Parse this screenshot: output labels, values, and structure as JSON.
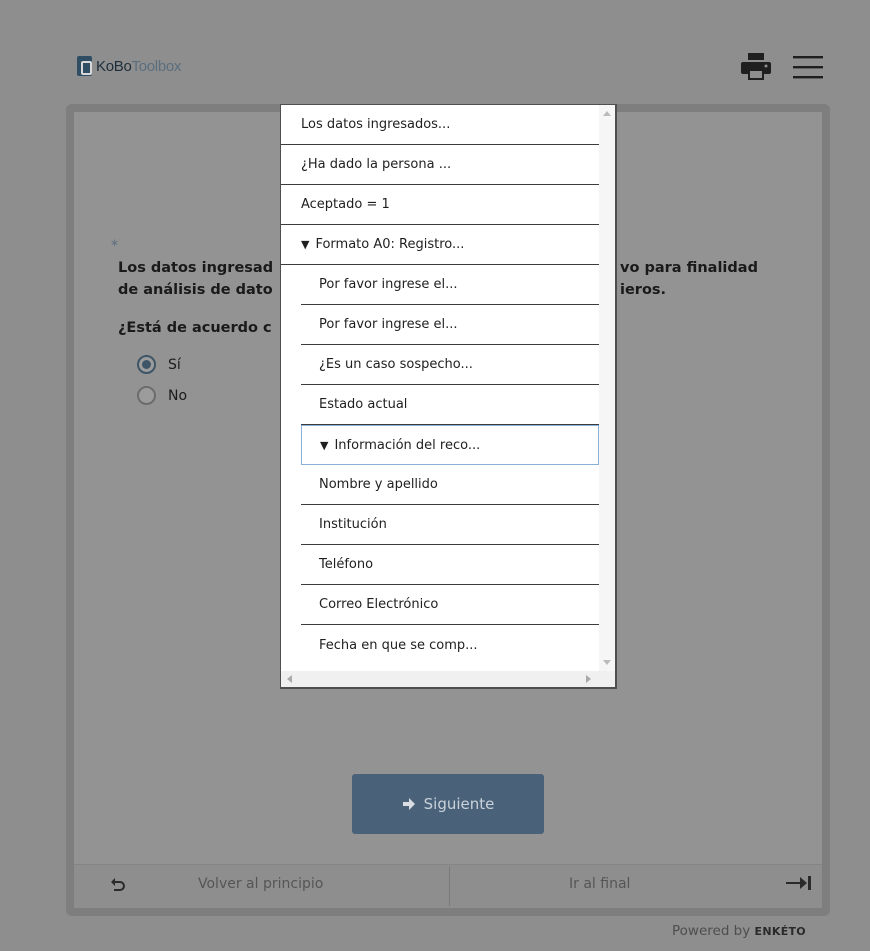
{
  "header": {
    "logo_ko": "KoBo",
    "logo_toolbox": "Toolbox",
    "print_icon": "printer-icon",
    "menu_icon": "hamburger-menu-icon"
  },
  "question": {
    "required_mark": "*",
    "label_line1": "Los datos ingresad",
    "label_line1_right": "vo para finalidad",
    "label_line2": "de análisis de dato",
    "label_line2_right": "ieros.",
    "hint": "¿Está de acuerdo c",
    "options": [
      {
        "label": "Sí",
        "checked": true
      },
      {
        "label": "No",
        "checked": false
      }
    ]
  },
  "toc": {
    "items": [
      {
        "label": "Los datos ingresados...",
        "level": 0,
        "group": false
      },
      {
        "label": "¿Ha dado la persona ...",
        "level": 0,
        "group": false
      },
      {
        "label": "Aceptado = 1",
        "level": 0,
        "group": false
      },
      {
        "label": "Formato A0: Registro...",
        "level": 0,
        "group": true
      },
      {
        "label": "Por favor ingrese el...",
        "level": 1,
        "group": false
      },
      {
        "label": "Por favor ingrese el...",
        "level": 1,
        "group": false
      },
      {
        "label": "¿Es un caso sospecho...",
        "level": 1,
        "group": false
      },
      {
        "label": "Estado actual",
        "level": 1,
        "group": false
      },
      {
        "label": "Información del reco...",
        "level": 1,
        "group": true,
        "active": true
      },
      {
        "label": "Nombre y apellido",
        "level": 1,
        "group": false
      },
      {
        "label": "Institución",
        "level": 1,
        "group": false
      },
      {
        "label": "Teléfono",
        "level": 1,
        "group": false
      },
      {
        "label": "Correo Electrónico",
        "level": 1,
        "group": false
      },
      {
        "label": "Fecha en que se comp...",
        "level": 1,
        "group": false
      }
    ]
  },
  "nav": {
    "next_label": "Siguiente",
    "back_label": "Volver al principio",
    "end_label": "Ir al final"
  },
  "footer": {
    "powered_by": "Powered by",
    "brand": "ENKÉTO"
  },
  "colors": {
    "overlay_bg": "#8e8e8e",
    "button_bg": "#4a6279",
    "logo_blue": "#2f4d63",
    "toc_bg": "#ffffff",
    "active_border": "#8ab0d6"
  }
}
